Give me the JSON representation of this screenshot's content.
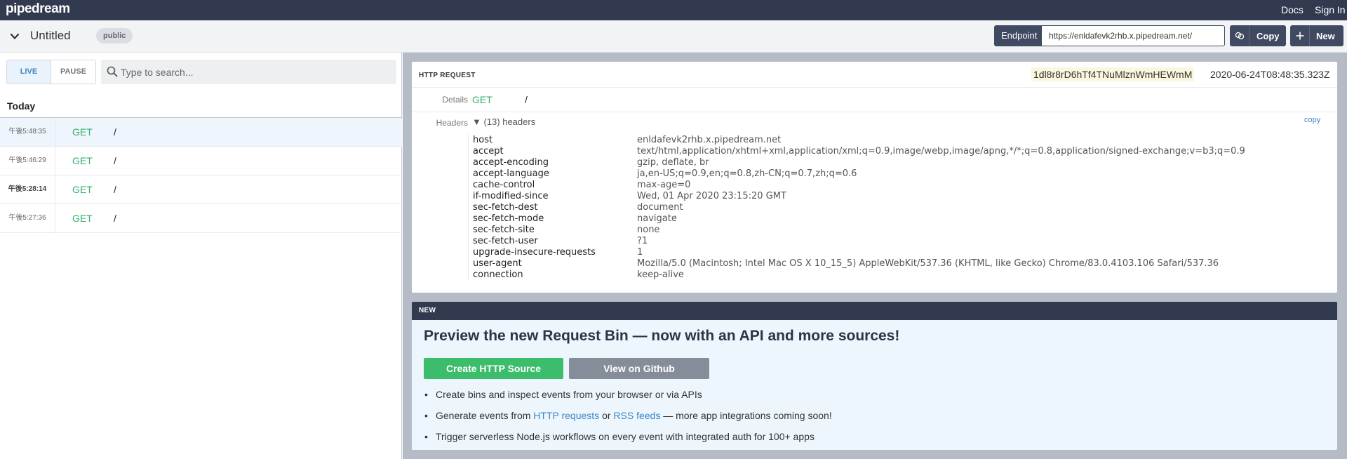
{
  "topbar": {
    "brand": "pipedream",
    "docs": "Docs",
    "sign_in": "Sign In"
  },
  "titlebar": {
    "title": "Untitled",
    "badge": "public",
    "endpoint_label": "Endpoint",
    "endpoint_url": "https://enldafevk2rhb.x.pipedream.net/",
    "copy_label": "Copy",
    "new_label": "New"
  },
  "sidebar": {
    "live_label": "LIVE",
    "pause_label": "PAUSE",
    "search_placeholder": "Type to search...",
    "group_label": "Today",
    "requests": [
      {
        "time": "午後5:48:35",
        "method": "GET",
        "path": "/"
      },
      {
        "time": "午後5:46:29",
        "method": "GET",
        "path": "/"
      },
      {
        "time": "午後5:28:14",
        "method": "GET",
        "path": "/"
      },
      {
        "time": "午後5:27:36",
        "method": "GET",
        "path": "/"
      }
    ]
  },
  "request": {
    "label": "HTTP REQUEST",
    "id": "1dl8r8rD6hTf4TNuMlznWmHEWmM",
    "timestamp": "2020-06-24T08:48:35.323Z",
    "details_label": "Details",
    "method": "GET",
    "path": "/",
    "headers_label": "Headers",
    "headers_toggle": "▼ (13) headers",
    "copy_link": "copy",
    "headers": [
      {
        "key": "host",
        "value": "enldafevk2rhb.x.pipedream.net"
      },
      {
        "key": "accept",
        "value": "text/html,application/xhtml+xml,application/xml;q=0.9,image/webp,image/apng,*/*;q=0.8,application/signed-exchange;v=b3;q=0.9"
      },
      {
        "key": "accept-encoding",
        "value": "gzip, deflate, br"
      },
      {
        "key": "accept-language",
        "value": "ja,en-US;q=0.9,en;q=0.8,zh-CN;q=0.7,zh;q=0.6"
      },
      {
        "key": "cache-control",
        "value": "max-age=0"
      },
      {
        "key": "if-modified-since",
        "value": "Wed, 01 Apr 2020 23:15:20 GMT"
      },
      {
        "key": "sec-fetch-dest",
        "value": "document"
      },
      {
        "key": "sec-fetch-mode",
        "value": "navigate"
      },
      {
        "key": "sec-fetch-site",
        "value": "none"
      },
      {
        "key": "sec-fetch-user",
        "value": "?1"
      },
      {
        "key": "upgrade-insecure-requests",
        "value": "1"
      },
      {
        "key": "user-agent",
        "value": "Mozilla/5.0 (Macintosh; Intel Mac OS X 10_15_5) AppleWebKit/537.36 (KHTML, like Gecko) Chrome/83.0.4103.106 Safari/537.36"
      },
      {
        "key": "connection",
        "value": "keep-alive"
      }
    ]
  },
  "promo": {
    "label": "NEW",
    "title": "Preview the new Request Bin — now with an API and more sources!",
    "create_button": "Create HTTP Source",
    "github_button": "View on Github",
    "item1": "Create bins and inspect events from your browser or via APIs",
    "item2_prefix": "Generate events from ",
    "item2_link1": "HTTP requests",
    "item2_mid": " or ",
    "item2_link2": "RSS feeds",
    "item2_suffix": " — more app integrations coming soon!",
    "item3": "Trigger serverless Node.js workflows on every event with integrated auth for 100+ apps"
  },
  "colors": {
    "nav": "#323a4f",
    "method_get": "#2fb16b",
    "link": "#3b86c6",
    "create_button": "#3bbd6b"
  }
}
